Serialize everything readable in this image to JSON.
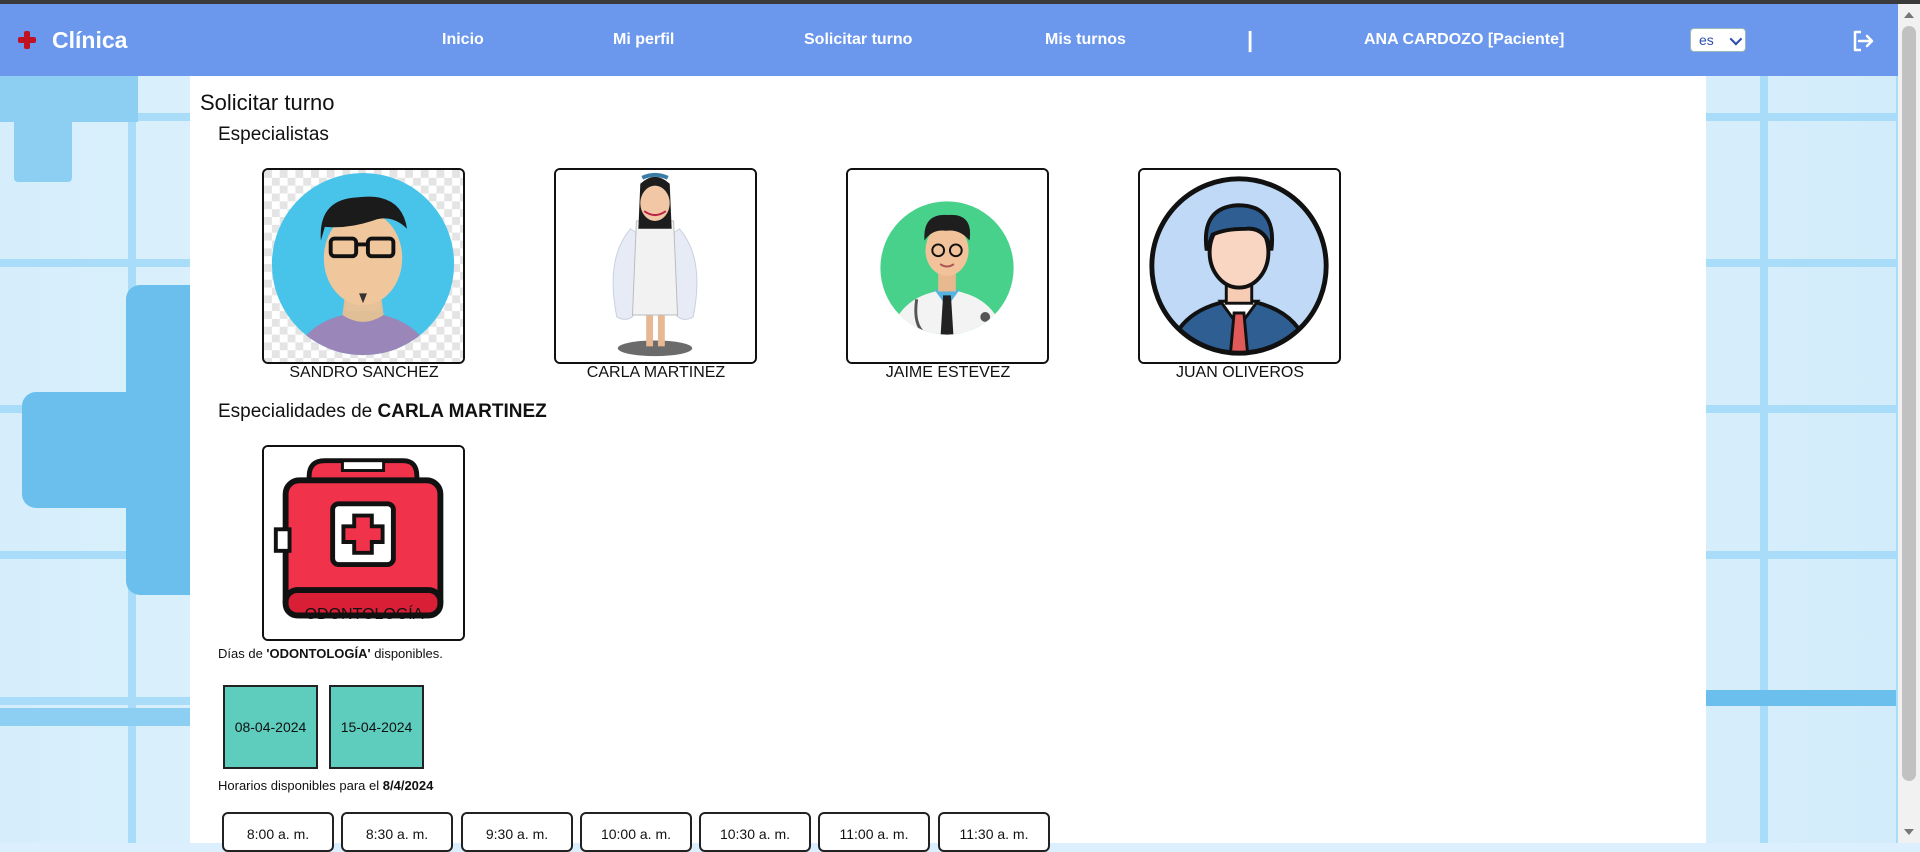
{
  "brand": {
    "name": "Clínica",
    "icon": "medical-cross-icon",
    "accent": "#c1121f"
  },
  "nav": {
    "links": [
      {
        "label": "Inicio"
      },
      {
        "label": "Mi perfil"
      },
      {
        "label": "Solicitar turno"
      },
      {
        "label": "Mis turnos"
      }
    ],
    "separator": "|",
    "user": "ANA CARDOZO [Paciente]",
    "language": "es",
    "logout_icon": "logout-icon",
    "color": "#6b97ec"
  },
  "page": {
    "title": "Solicitar turno",
    "specialists_heading": "Especialistas",
    "specialists": [
      {
        "name": "SANDRO SANCHEZ",
        "icon": "avatar-glasses-man"
      },
      {
        "name": "CARLA MARTINEZ",
        "icon": "avatar-doctor-woman"
      },
      {
        "name": "JAIME ESTEVEZ",
        "icon": "avatar-doctor-man"
      },
      {
        "name": "JUAN OLIVEROS",
        "icon": "avatar-businessman"
      }
    ],
    "specialties_prefix": "Especialidades de ",
    "specialties_doctor": "CARLA MARTINEZ",
    "specialties": [
      {
        "name": "ODONTOLOGÍA",
        "icon": "first-aid-kit-icon"
      }
    ],
    "days_prefix": "Días de ",
    "days_specialty": "'ODONTOLOGÍA'",
    "days_suffix": " disponibles.",
    "days": [
      "08-04-2024",
      "15-04-2024"
    ],
    "hours_prefix": "Horarios disponibles para el ",
    "hours_date": "8/4/2024",
    "hours": [
      "8:00 a. m.",
      "8:30 a. m.",
      "9:30 a. m.",
      "10:00 a. m.",
      "10:30 a. m.",
      "11:00 a. m.",
      "11:30 a. m."
    ],
    "day_color": "#5ecdbd"
  }
}
